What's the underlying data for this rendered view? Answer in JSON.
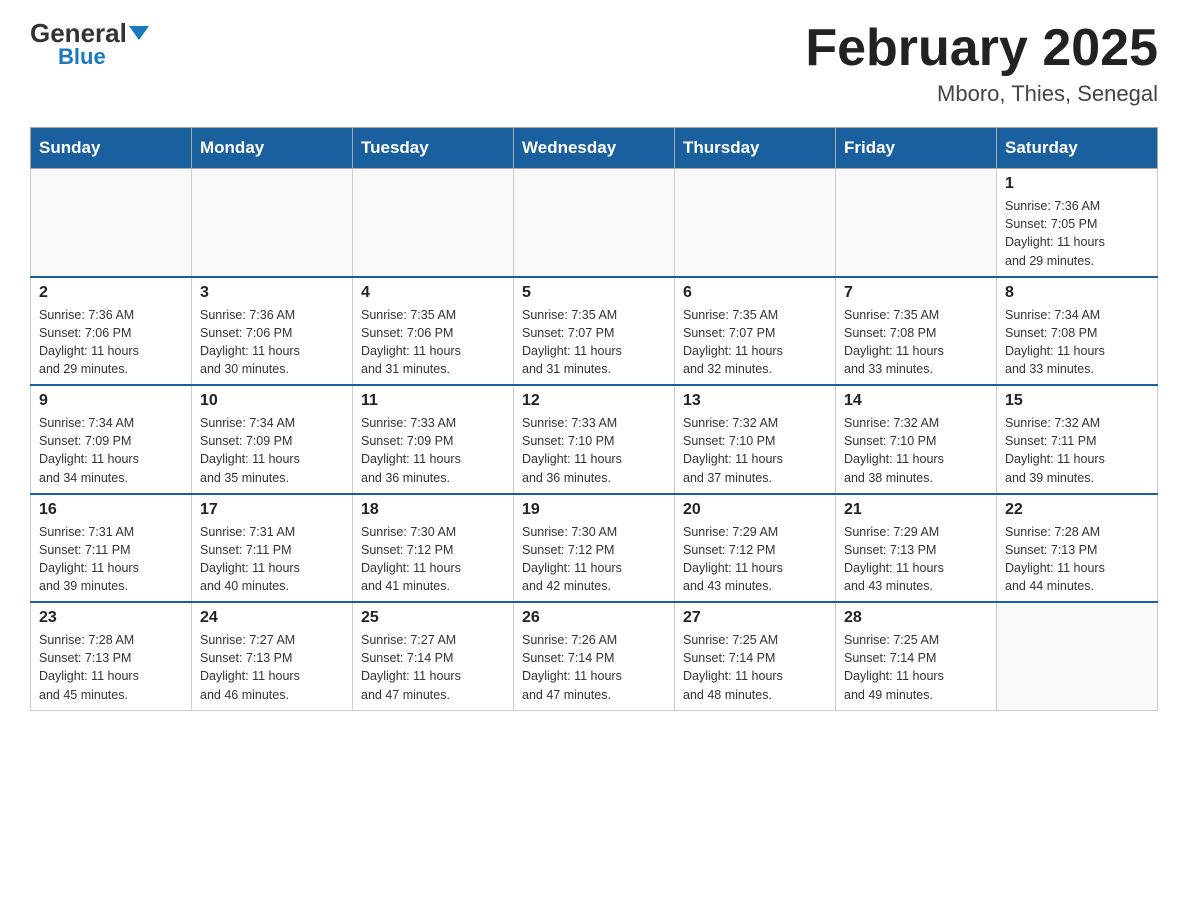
{
  "header": {
    "logo_general": "General",
    "logo_blue": "Blue",
    "month_title": "February 2025",
    "location": "Mboro, Thies, Senegal"
  },
  "weekdays": [
    "Sunday",
    "Monday",
    "Tuesday",
    "Wednesday",
    "Thursday",
    "Friday",
    "Saturday"
  ],
  "weeks": [
    [
      {
        "day": "",
        "info": ""
      },
      {
        "day": "",
        "info": ""
      },
      {
        "day": "",
        "info": ""
      },
      {
        "day": "",
        "info": ""
      },
      {
        "day": "",
        "info": ""
      },
      {
        "day": "",
        "info": ""
      },
      {
        "day": "1",
        "info": "Sunrise: 7:36 AM\nSunset: 7:05 PM\nDaylight: 11 hours\nand 29 minutes."
      }
    ],
    [
      {
        "day": "2",
        "info": "Sunrise: 7:36 AM\nSunset: 7:06 PM\nDaylight: 11 hours\nand 29 minutes."
      },
      {
        "day": "3",
        "info": "Sunrise: 7:36 AM\nSunset: 7:06 PM\nDaylight: 11 hours\nand 30 minutes."
      },
      {
        "day": "4",
        "info": "Sunrise: 7:35 AM\nSunset: 7:06 PM\nDaylight: 11 hours\nand 31 minutes."
      },
      {
        "day": "5",
        "info": "Sunrise: 7:35 AM\nSunset: 7:07 PM\nDaylight: 11 hours\nand 31 minutes."
      },
      {
        "day": "6",
        "info": "Sunrise: 7:35 AM\nSunset: 7:07 PM\nDaylight: 11 hours\nand 32 minutes."
      },
      {
        "day": "7",
        "info": "Sunrise: 7:35 AM\nSunset: 7:08 PM\nDaylight: 11 hours\nand 33 minutes."
      },
      {
        "day": "8",
        "info": "Sunrise: 7:34 AM\nSunset: 7:08 PM\nDaylight: 11 hours\nand 33 minutes."
      }
    ],
    [
      {
        "day": "9",
        "info": "Sunrise: 7:34 AM\nSunset: 7:09 PM\nDaylight: 11 hours\nand 34 minutes."
      },
      {
        "day": "10",
        "info": "Sunrise: 7:34 AM\nSunset: 7:09 PM\nDaylight: 11 hours\nand 35 minutes."
      },
      {
        "day": "11",
        "info": "Sunrise: 7:33 AM\nSunset: 7:09 PM\nDaylight: 11 hours\nand 36 minutes."
      },
      {
        "day": "12",
        "info": "Sunrise: 7:33 AM\nSunset: 7:10 PM\nDaylight: 11 hours\nand 36 minutes."
      },
      {
        "day": "13",
        "info": "Sunrise: 7:32 AM\nSunset: 7:10 PM\nDaylight: 11 hours\nand 37 minutes."
      },
      {
        "day": "14",
        "info": "Sunrise: 7:32 AM\nSunset: 7:10 PM\nDaylight: 11 hours\nand 38 minutes."
      },
      {
        "day": "15",
        "info": "Sunrise: 7:32 AM\nSunset: 7:11 PM\nDaylight: 11 hours\nand 39 minutes."
      }
    ],
    [
      {
        "day": "16",
        "info": "Sunrise: 7:31 AM\nSunset: 7:11 PM\nDaylight: 11 hours\nand 39 minutes."
      },
      {
        "day": "17",
        "info": "Sunrise: 7:31 AM\nSunset: 7:11 PM\nDaylight: 11 hours\nand 40 minutes."
      },
      {
        "day": "18",
        "info": "Sunrise: 7:30 AM\nSunset: 7:12 PM\nDaylight: 11 hours\nand 41 minutes."
      },
      {
        "day": "19",
        "info": "Sunrise: 7:30 AM\nSunset: 7:12 PM\nDaylight: 11 hours\nand 42 minutes."
      },
      {
        "day": "20",
        "info": "Sunrise: 7:29 AM\nSunset: 7:12 PM\nDaylight: 11 hours\nand 43 minutes."
      },
      {
        "day": "21",
        "info": "Sunrise: 7:29 AM\nSunset: 7:13 PM\nDaylight: 11 hours\nand 43 minutes."
      },
      {
        "day": "22",
        "info": "Sunrise: 7:28 AM\nSunset: 7:13 PM\nDaylight: 11 hours\nand 44 minutes."
      }
    ],
    [
      {
        "day": "23",
        "info": "Sunrise: 7:28 AM\nSunset: 7:13 PM\nDaylight: 11 hours\nand 45 minutes."
      },
      {
        "day": "24",
        "info": "Sunrise: 7:27 AM\nSunset: 7:13 PM\nDaylight: 11 hours\nand 46 minutes."
      },
      {
        "day": "25",
        "info": "Sunrise: 7:27 AM\nSunset: 7:14 PM\nDaylight: 11 hours\nand 47 minutes."
      },
      {
        "day": "26",
        "info": "Sunrise: 7:26 AM\nSunset: 7:14 PM\nDaylight: 11 hours\nand 47 minutes."
      },
      {
        "day": "27",
        "info": "Sunrise: 7:25 AM\nSunset: 7:14 PM\nDaylight: 11 hours\nand 48 minutes."
      },
      {
        "day": "28",
        "info": "Sunrise: 7:25 AM\nSunset: 7:14 PM\nDaylight: 11 hours\nand 49 minutes."
      },
      {
        "day": "",
        "info": ""
      }
    ]
  ]
}
